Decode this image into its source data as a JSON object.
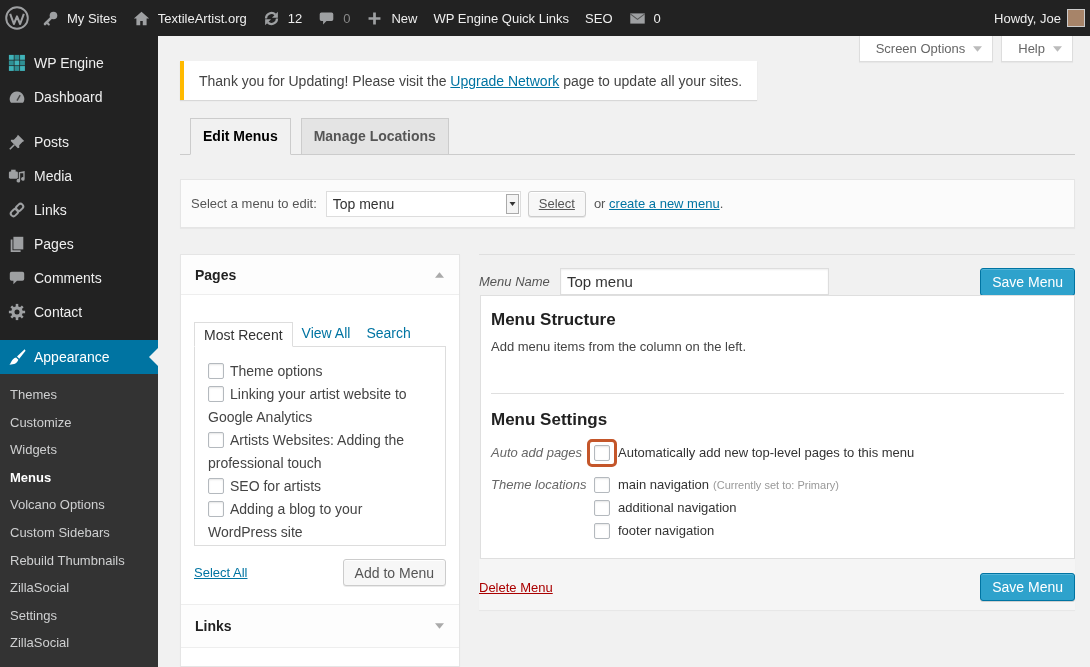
{
  "admin_bar": {
    "items": [
      {
        "label": "My Sites",
        "dimmed": false
      },
      {
        "label": "TextileArtist.org",
        "dimmed": false
      },
      {
        "label": "12",
        "dimmed": false
      },
      {
        "label": "0",
        "dimmed": true
      },
      {
        "label": "New",
        "dimmed": false
      },
      {
        "label": "WP Engine Quick Links",
        "dimmed": false
      },
      {
        "label": "SEO",
        "dimmed": false
      },
      {
        "label": "0",
        "dimmed": false
      }
    ],
    "greeting": "Howdy, Joe"
  },
  "sidebar": {
    "groups": [
      {
        "items": [
          {
            "label": "WP Engine",
            "selected": false
          },
          {
            "label": "Dashboard",
            "selected": false
          }
        ]
      },
      {
        "items": [
          {
            "label": "Posts",
            "selected": false
          },
          {
            "label": "Media",
            "selected": false
          },
          {
            "label": "Links",
            "selected": false
          },
          {
            "label": "Pages",
            "selected": false
          },
          {
            "label": "Comments",
            "selected": false
          },
          {
            "label": "Contact",
            "selected": false
          }
        ]
      },
      {
        "items": [
          {
            "label": "Appearance",
            "selected": true,
            "children": [
              {
                "label": "Themes",
                "selected": false
              },
              {
                "label": "Customize",
                "selected": false
              },
              {
                "label": "Widgets",
                "selected": false
              },
              {
                "label": "Menus",
                "selected": true
              },
              {
                "label": "Volcano Options",
                "selected": false
              },
              {
                "label": "Custom Sidebars",
                "selected": false
              },
              {
                "label": "Rebuild Thumbnails",
                "selected": false
              },
              {
                "label": "ZillaSocial",
                "selected": false
              },
              {
                "label": "Settings",
                "selected": false
              },
              {
                "label": "ZillaSocial",
                "selected": false
              }
            ]
          }
        ]
      }
    ]
  },
  "screen_meta": [
    {
      "label": "Screen Options",
      "expanded": false
    },
    {
      "label": "Help",
      "expanded": false
    }
  ],
  "notice": {
    "before": "Thank you for Updating! Please visit the ",
    "link": "Upgrade Network",
    "after": " page to update all your sites."
  },
  "tabs": [
    {
      "label": "Edit Menus",
      "selected": true
    },
    {
      "label": "Manage Locations",
      "selected": false
    }
  ],
  "menu_select": {
    "label": "Select a menu to edit:",
    "value": "Top menu",
    "button": "Select",
    "before": "or ",
    "link": "create a new menu",
    "after": "."
  },
  "add_items": {
    "sections": [
      {
        "title": "Pages",
        "expanded": true,
        "tabs": [
          {
            "label": "Most Recent",
            "selected": true
          },
          {
            "label": "View All",
            "selected": false
          },
          {
            "label": "Search",
            "selected": false
          }
        ],
        "items": [
          {
            "label": "Theme options",
            "checked": false
          },
          {
            "label": "Linking your artist website to Google Analytics",
            "checked": false
          },
          {
            "label": "Artists Websites: Adding the professional touch",
            "checked": false
          },
          {
            "label": "SEO for artists",
            "checked": false
          },
          {
            "label": "Adding a blog to your WordPress site",
            "checked": false
          }
        ],
        "select_all": "Select All",
        "add_button": "Add to Menu"
      },
      {
        "title": "Links",
        "expanded": false
      }
    ]
  },
  "menu_editor": {
    "name_label": "Menu Name",
    "name_value": "Top menu",
    "save_button": "Save Menu",
    "structure": {
      "title": "Menu Structure",
      "text": "Add menu items from the column on the left."
    },
    "settings": {
      "title": "Menu Settings",
      "groups": [
        {
          "label": "Auto add pages",
          "options": [
            {
              "label": "Automatically add new top-level pages to this menu",
              "checked": false,
              "highlighted": true
            }
          ]
        },
        {
          "label": "Theme locations",
          "options": [
            {
              "label": "main navigation",
              "note": "(Currently set to: Primary)",
              "checked": false,
              "highlighted": false
            },
            {
              "label": "additional navigation",
              "checked": false,
              "highlighted": false
            },
            {
              "label": "footer navigation",
              "checked": false,
              "highlighted": false
            }
          ]
        }
      ]
    },
    "delete_link": "Delete Menu",
    "footer_save_button": "Save Menu"
  }
}
